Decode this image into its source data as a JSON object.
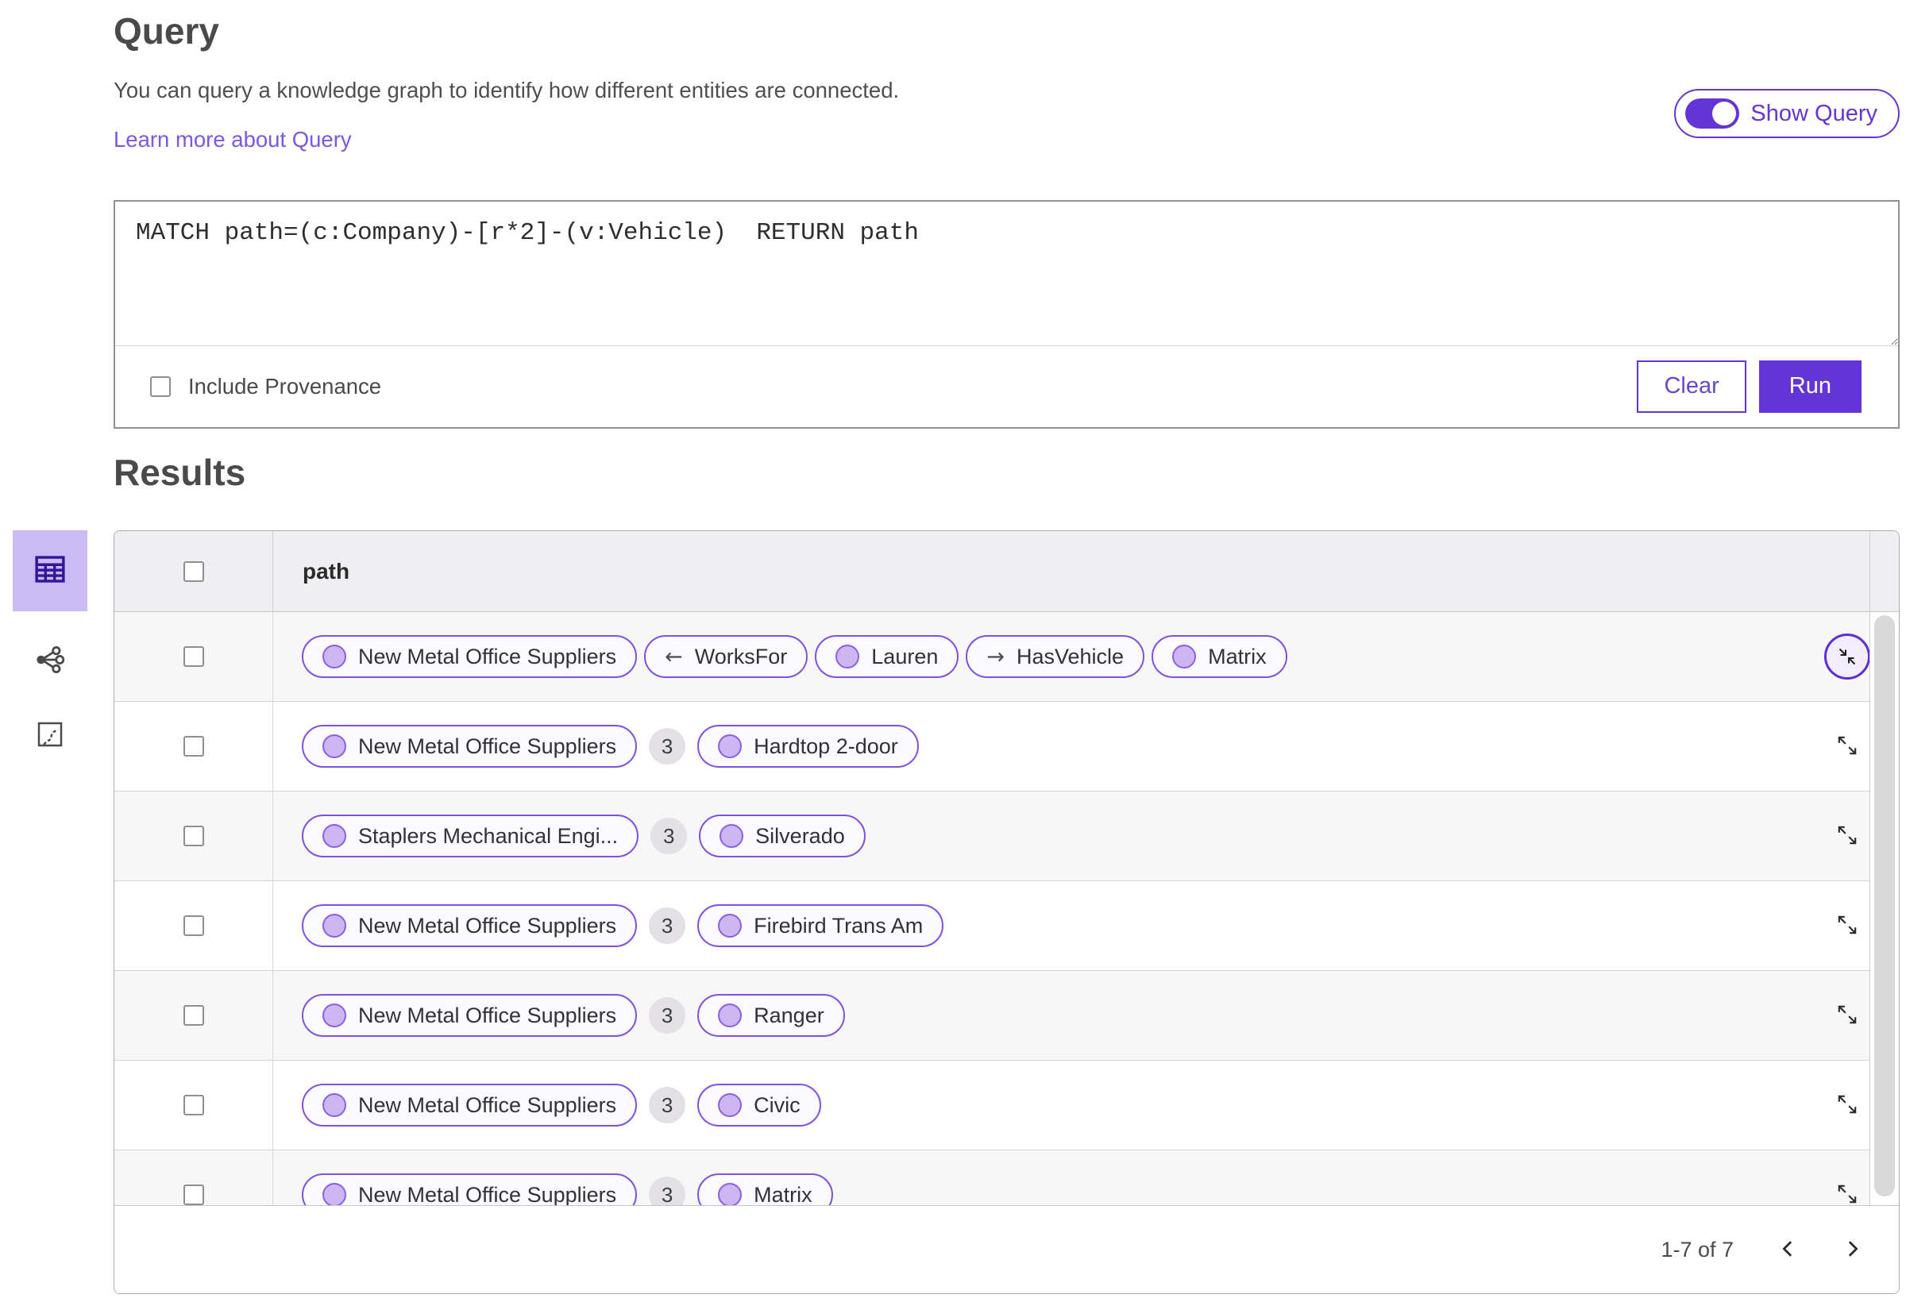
{
  "header": {
    "title": "Query",
    "description": "You can query a knowledge graph to identify how different entities are connected.",
    "learn_more_label": "Learn more about Query",
    "show_query": {
      "label": "Show Query",
      "enabled": true
    }
  },
  "query_panel": {
    "query_text": "MATCH path=(c:Company)-[r*2]-(v:Vehicle)  RETURN path",
    "include_provenance_label": "Include Provenance",
    "include_provenance_checked": false,
    "clear_label": "Clear",
    "run_label": "Run"
  },
  "results": {
    "title": "Results",
    "views": [
      {
        "name": "table-view",
        "icon": "table-icon",
        "selected": true
      },
      {
        "name": "link-chart-view",
        "icon": "link-chart-icon",
        "selected": false
      },
      {
        "name": "map-view",
        "icon": "map-icon",
        "selected": false
      }
    ],
    "table": {
      "column_header": "path",
      "rows": [
        {
          "state": "expanded",
          "items": [
            {
              "type": "entity",
              "label": "New Metal Office Suppliers"
            },
            {
              "type": "relationship",
              "arrow": "←",
              "label": "WorksFor"
            },
            {
              "type": "entity",
              "label": "Lauren"
            },
            {
              "type": "relationship",
              "arrow": "→",
              "label": "HasVehicle"
            },
            {
              "type": "entity",
              "label": "Matrix"
            }
          ]
        },
        {
          "source": "New Metal Office Suppliers",
          "count": "3",
          "target": "Hardtop 2-door"
        },
        {
          "source": "Staplers Mechanical Engi...",
          "count": "3",
          "target": "Silverado"
        },
        {
          "source": "New Metal Office Suppliers",
          "count": "3",
          "target": "Firebird Trans Am"
        },
        {
          "source": "New Metal Office Suppliers",
          "count": "3",
          "target": "Ranger"
        },
        {
          "source": "New Metal Office Suppliers",
          "count": "3",
          "target": "Civic"
        },
        {
          "source": "New Metal Office Suppliers",
          "count": "3",
          "target": "Matrix"
        }
      ],
      "pagination": {
        "range_label": "1-7 of 7"
      }
    }
  },
  "colors": {
    "accent_purple": "#6435d6",
    "pill_border_purple": "#7e50e3",
    "selected_view_bg": "#cbbaf3",
    "link_purple": "#7b57e6",
    "node_dot_fill": "#ccb7f3"
  }
}
